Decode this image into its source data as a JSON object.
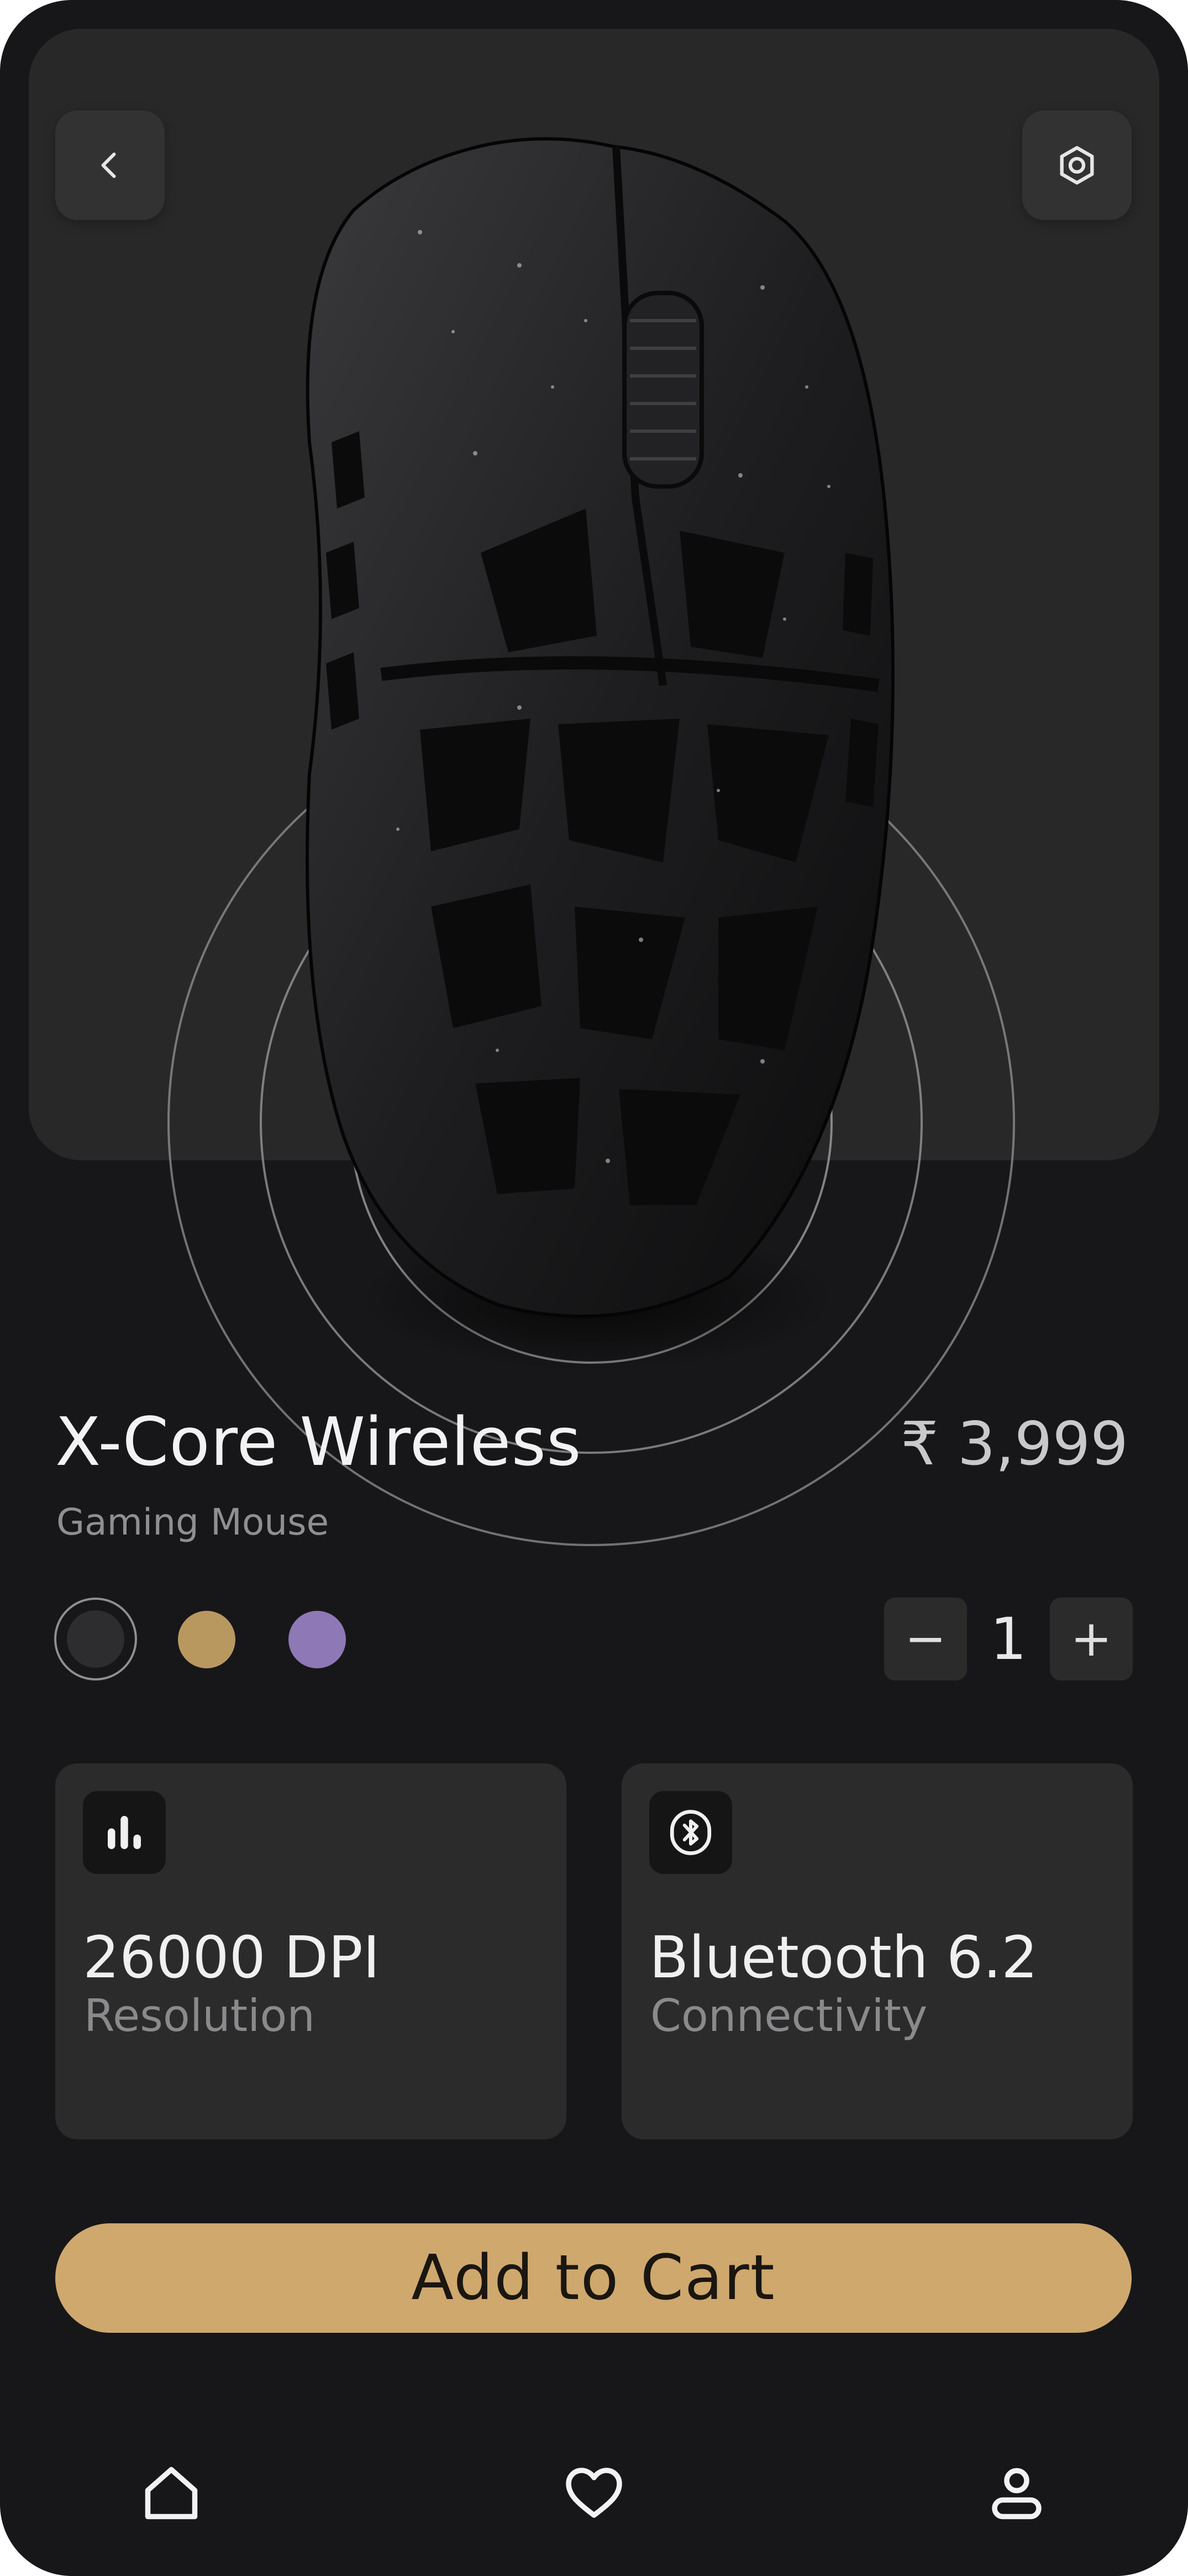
{
  "product": {
    "name": "X-Core Wireless",
    "category": "Gaming Mouse",
    "price": "₹ 3,999"
  },
  "colors": {
    "background": "#171719",
    "hero_panel": "#282829",
    "accent": "#cfa86e",
    "options": [
      {
        "name": "black",
        "hex": "#2d2d2f",
        "selected": true
      },
      {
        "name": "gold",
        "hex": "#b99860",
        "selected": false
      },
      {
        "name": "lavender",
        "hex": "#8e78b6",
        "selected": false
      }
    ]
  },
  "quantity": {
    "minus": "−",
    "value": "1",
    "plus": "+"
  },
  "specs": [
    {
      "icon": "bar-chart-icon",
      "value": "26000 DPI",
      "label": "Resolution"
    },
    {
      "icon": "bluetooth-icon",
      "value": "Bluetooth 6.2",
      "label": "Connectivity"
    }
  ],
  "cta": {
    "label": "Add to Cart"
  },
  "header": {
    "back_icon": "chevron-left-icon",
    "ar_icon": "hexagon-target-icon"
  },
  "nav": {
    "items": [
      "home-icon",
      "heart-icon",
      "user-icon"
    ]
  }
}
